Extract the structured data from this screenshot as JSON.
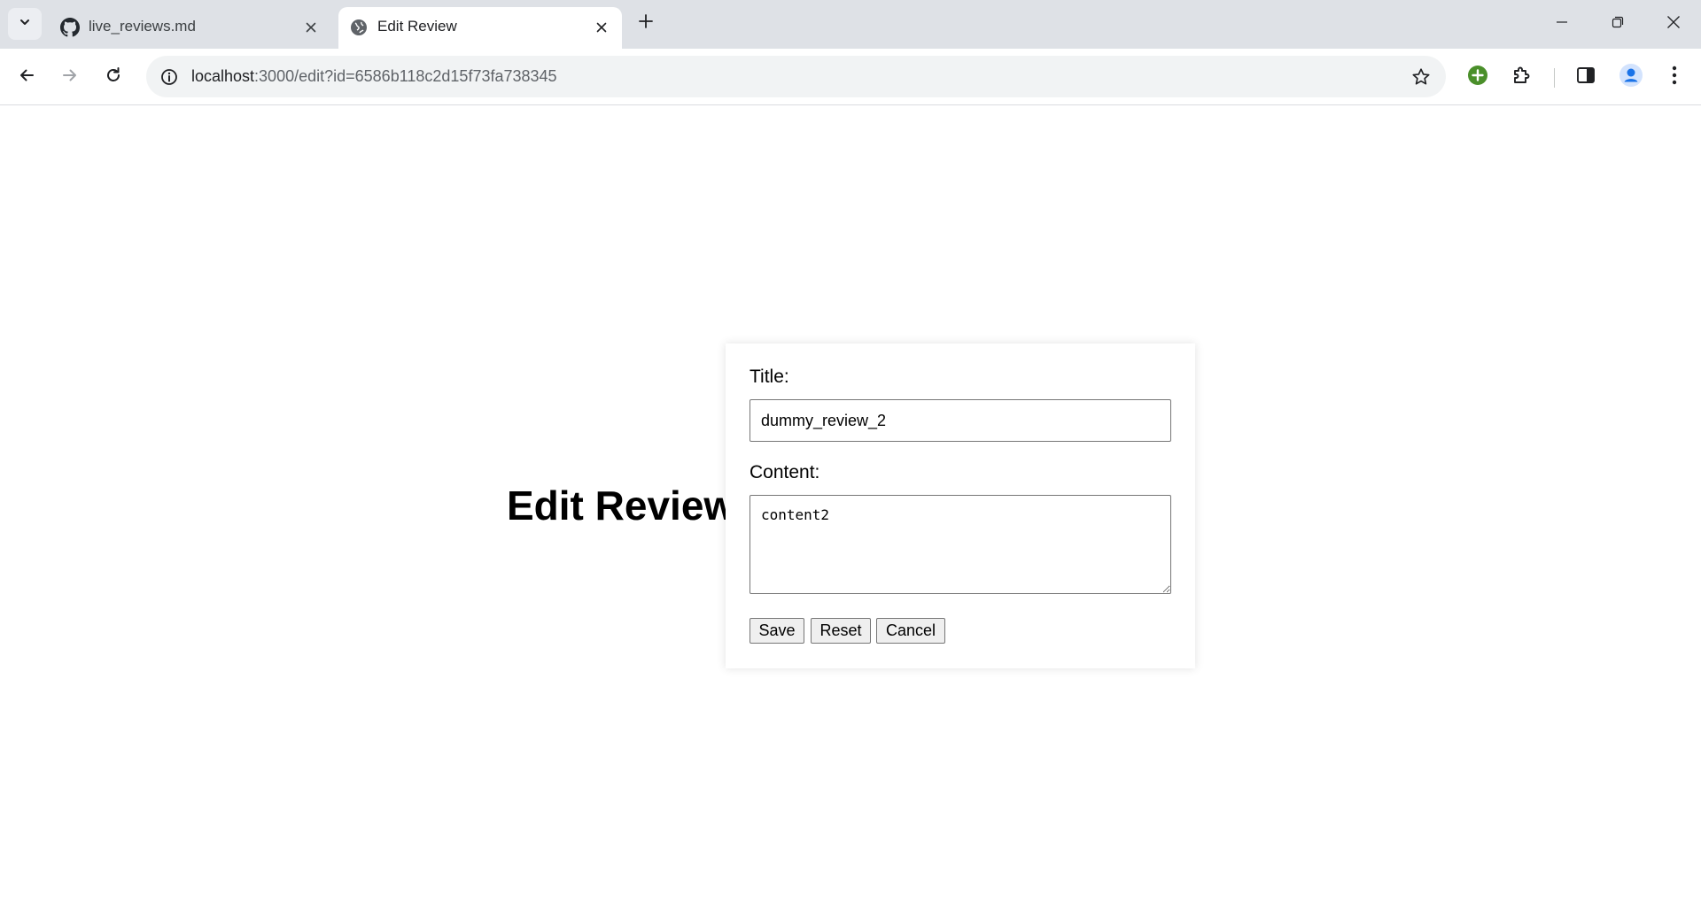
{
  "browser": {
    "tabs": [
      {
        "title": "live_reviews.md",
        "icon": "github-icon",
        "active": false
      },
      {
        "title": "Edit Review",
        "icon": "globe-icon",
        "active": true
      }
    ],
    "url_host": "localhost",
    "url_rest": ":3000/edit?id=6586b118c2d15f73fa738345",
    "colors": {
      "tabstrip": "#dee1e6",
      "omnibox": "#f1f3f4",
      "extension_green": "#34a853",
      "profile_blue": "#1a73e8"
    }
  },
  "page": {
    "heading": "Edit Review",
    "form": {
      "title_label": "Title:",
      "title_value": "dummy_review_2",
      "content_label": "Content:",
      "content_value": "content2",
      "buttons": {
        "save": "Save",
        "reset": "Reset",
        "cancel": "Cancel"
      }
    }
  }
}
